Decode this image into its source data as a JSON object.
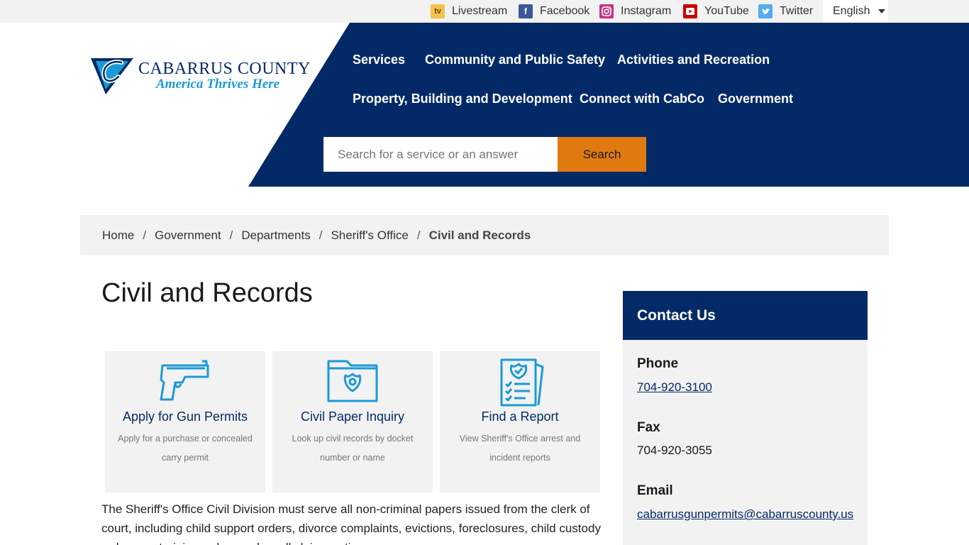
{
  "topbar": {
    "links": [
      {
        "label": "Livestream",
        "icon": "tv-icon",
        "color": "#f2c34a"
      },
      {
        "label": "Facebook",
        "icon": "facebook-icon",
        "color": "#3b5998"
      },
      {
        "label": "Instagram",
        "icon": "instagram-icon",
        "color": "#c13584"
      },
      {
        "label": "YouTube",
        "icon": "youtube-icon",
        "color": "#cc0000"
      },
      {
        "label": "Twitter",
        "icon": "twitter-icon",
        "color": "#55acee"
      }
    ],
    "language": "English"
  },
  "logo": {
    "name": "CABARRUS COUNTY",
    "tagline": "America Thrives Here"
  },
  "nav": {
    "items": [
      "Services",
      "Community and Public Safety",
      "Activities and Recreation",
      "Property, Building and Development",
      "Connect with CabCo",
      "Government"
    ]
  },
  "search": {
    "placeholder": "Search for a service or an answer",
    "button": "Search"
  },
  "breadcrumb": [
    "Home",
    "Government",
    "Departments",
    "Sheriff's Office",
    "Civil and Records"
  ],
  "page": {
    "title": "Civil and Records",
    "body": "The Sheriff's Office Civil Division must serve all non-criminal papers issued from the clerk of court, including child support orders, divorce complaints, evictions, foreclosures, child custody orders, restraining orders and small claims actions."
  },
  "cards": [
    {
      "title": "Apply for Gun Permits",
      "desc": "Apply for a purchase or concealed carry permit",
      "icon": "handgun-icon"
    },
    {
      "title": "Civil Paper Inquiry",
      "desc": "Look up civil records by docket number or name",
      "icon": "folder-badge-icon"
    },
    {
      "title": "Find a Report",
      "desc": "View Sheriff's Office arrest and incident reports",
      "icon": "report-checklist-icon"
    }
  ],
  "contact": {
    "heading": "Contact Us",
    "phone_label": "Phone",
    "phone": "704-920-3100",
    "fax_label": "Fax",
    "fax": "704-920-3055",
    "email_label": "Email",
    "email": "cabarrusgunpermits@cabarruscounty.us"
  },
  "colors": {
    "navy": "#032a66",
    "orange": "#e07a10",
    "icon_blue": "#1a9ad6"
  }
}
